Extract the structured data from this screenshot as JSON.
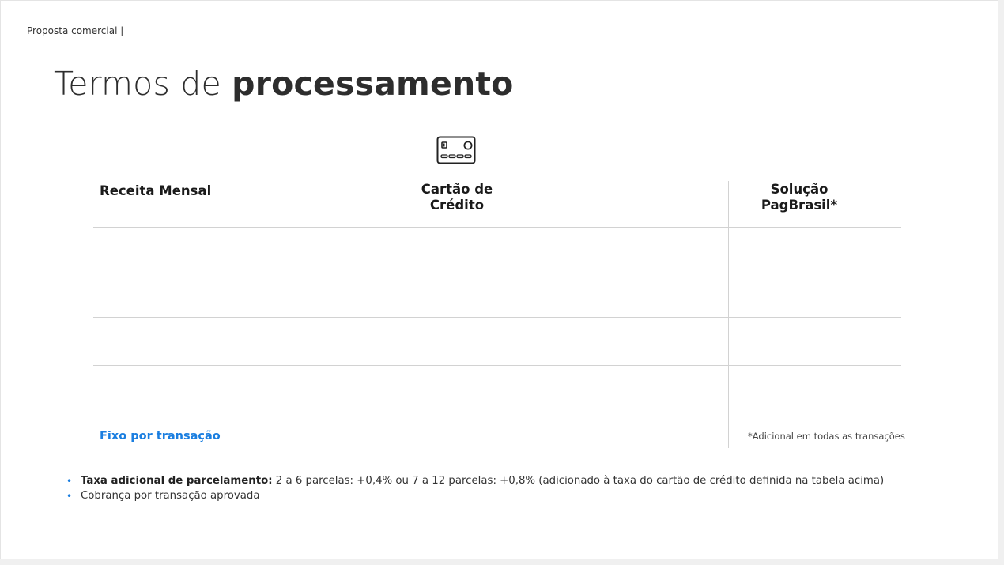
{
  "header": {
    "label": "Proposta comercial |"
  },
  "title": {
    "light": "Termos de ",
    "bold": "processamento"
  },
  "icons": {
    "card": "credit-card-icon"
  },
  "table": {
    "columns": {
      "receita": "Receita Mensal",
      "cartao_line1": "Cartão de",
      "cartao_line2": "Crédito",
      "solucao_line1": "Solução",
      "solucao_line2": "PagBrasil*"
    },
    "fixo_label": "Fixo por transação",
    "footnote": "*Adicional em todas as transações"
  },
  "notes": {
    "bullet_glyph": "•",
    "item1_strong": "Taxa adicional de parcelamento:",
    "item1_text": " 2 a 6 parcelas: +0,4% ou 7 a 12 parcelas: +0,8% (adicionado à taxa do cartão de crédito definida na tabela acima)",
    "item2_text": "Cobrança por transação aprovada"
  },
  "colors": {
    "accent": "#1a7ee0",
    "text": "#222222",
    "rule": "#d2d2d2"
  }
}
